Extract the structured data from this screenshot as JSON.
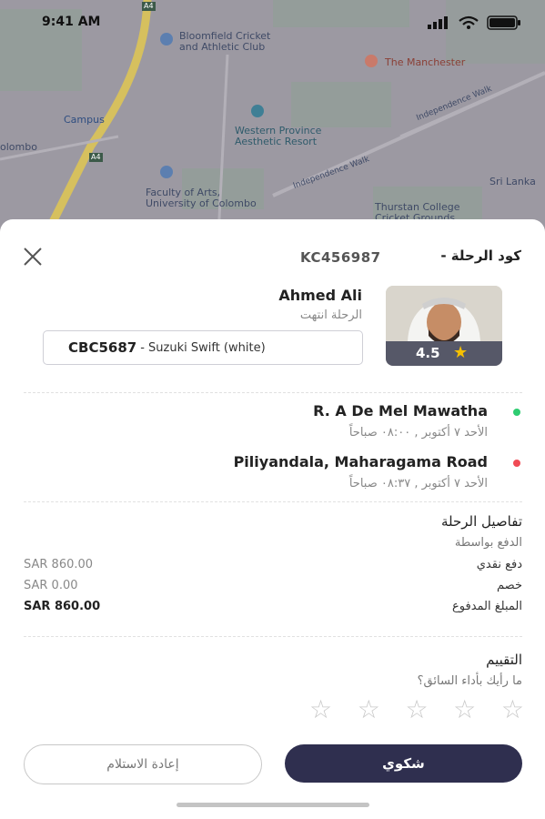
{
  "status_bar": {
    "time": "9:41 AM"
  },
  "map": {
    "labels": [
      "Bloomfield Cricket\nand Athletic Club",
      "The Manchester",
      "Campus",
      "olombo",
      "Western Province\nAesthetic Resort",
      "Faculty of Arts,\nUniversity of Colombo",
      "Independence Walk",
      "Independence Walk",
      "Sri Lanka",
      "Thurstan College\nCricket Grounds",
      "A4",
      "A4"
    ]
  },
  "header": {
    "trip_code_label": "كود الرحلة -",
    "trip_code": "KC456987"
  },
  "driver": {
    "name": "Ahmed Ali",
    "status": "الرحلة انتهت",
    "rating": "4.5",
    "vehicle_plate": "CBC5687",
    "vehicle_model": "- Suzuki Swift (white)"
  },
  "route": {
    "pickup": {
      "name": "R. A De Mel Mawatha",
      "time": "الأحد ٧ أكتوبر , ٠٨:٠٠ صباحاً",
      "color": "#2ecc71"
    },
    "dropoff": {
      "name": "Piliyandala, Maharagama Road",
      "time": "الأحد ٧ أكتوبر , ٠٨:٣٧ صباحاً",
      "color": "#f04b55"
    }
  },
  "details": {
    "title": "تفاصيل الرحلة",
    "payment_by": "الدفع بواسطة",
    "rows": [
      {
        "label": "دفع نقدي",
        "value": "SAR 860.00"
      },
      {
        "label": "خصم",
        "value": "SAR 0.00"
      },
      {
        "label": "المبلغ المدفوع",
        "value": "SAR 860.00"
      }
    ]
  },
  "rating_section": {
    "title": "التقييم",
    "question": "ما رأيك بأداء السائق؟",
    "stars_max": 5,
    "stars_selected": 0
  },
  "actions": {
    "reorder_label": "إعادة الاستلام",
    "complaint_label": "شكوي"
  },
  "colors": {
    "primary": "#2f2f4f",
    "rating_bar": "#565868",
    "star": "#f6c000"
  }
}
